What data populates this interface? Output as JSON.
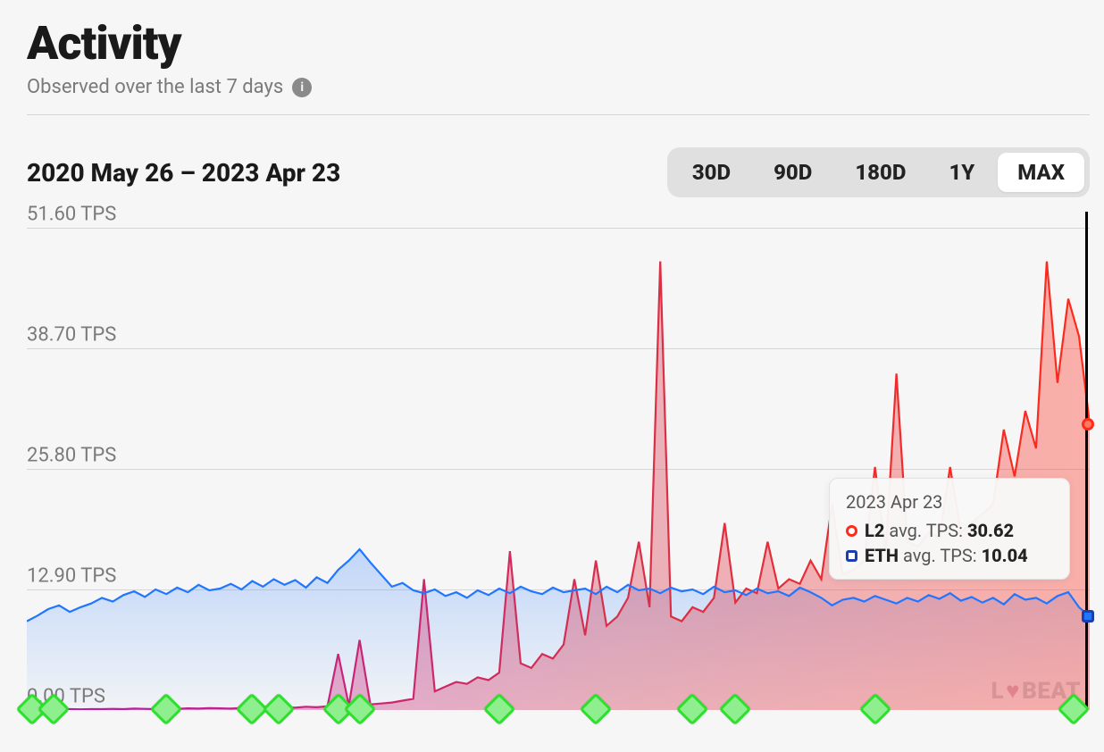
{
  "header": {
    "title": "Activity",
    "subtitle": "Observed over the last 7 days"
  },
  "range_label": "2020 May 26 – 2023 Apr 23",
  "range_options": [
    {
      "label": "30D",
      "active": false
    },
    {
      "label": "90D",
      "active": false
    },
    {
      "label": "180D",
      "active": false
    },
    {
      "label": "1Y",
      "active": false
    },
    {
      "label": "MAX",
      "active": true
    }
  ],
  "y_ticks": [
    "51.60 TPS",
    "38.70 TPS",
    "25.80 TPS",
    "12.90 TPS",
    "0.00 TPS"
  ],
  "tooltip": {
    "date": "2023 Apr 23",
    "l2_label": "L2",
    "l2_metric": "avg. TPS:",
    "l2_value": "30.62",
    "eth_label": "ETH",
    "eth_metric": "avg. TPS:",
    "eth_value": "10.04"
  },
  "watermark": "BEAT",
  "chart_data": {
    "type": "line",
    "title": "Activity",
    "xlabel": "",
    "ylabel": "TPS",
    "ylim": [
      0,
      51.6
    ],
    "x": [
      0,
      1,
      2,
      3,
      4,
      5,
      6,
      7,
      8,
      9,
      10,
      11,
      12,
      13,
      14,
      15,
      16,
      17,
      18,
      19,
      20,
      21,
      22,
      23,
      24,
      25,
      26,
      27,
      28,
      29,
      30,
      31,
      32,
      33,
      34,
      35,
      36,
      37,
      38,
      39,
      40,
      41,
      42,
      43,
      44,
      45,
      46,
      47,
      48,
      49,
      50,
      51,
      52,
      53,
      54,
      55,
      56,
      57,
      58,
      59,
      60,
      61,
      62,
      63,
      64,
      65,
      66,
      67,
      68,
      69,
      70,
      71,
      72,
      73,
      74,
      75,
      76,
      77,
      78,
      79,
      80,
      81,
      82,
      83,
      84,
      85,
      86,
      87,
      88,
      89,
      90,
      91,
      92,
      93,
      94,
      95,
      96,
      97,
      98,
      99
    ],
    "x_domain_label": [
      "2020 May 26",
      "2023 Apr 23"
    ],
    "series": [
      {
        "name": "ETH avg. TPS",
        "color": "#2176ff",
        "values": [
          9.5,
          10.1,
          10.8,
          11.2,
          10.5,
          11.0,
          11.4,
          12.0,
          11.6,
          12.3,
          12.7,
          12.1,
          12.9,
          12.4,
          13.1,
          12.6,
          13.4,
          12.8,
          13.0,
          13.5,
          12.9,
          13.8,
          13.2,
          14.0,
          13.4,
          13.9,
          13.1,
          14.2,
          13.6,
          15.0,
          16.0,
          17.2,
          15.8,
          14.5,
          13.2,
          13.6,
          12.8,
          12.5,
          12.9,
          12.2,
          12.6,
          12.0,
          12.8,
          12.3,
          13.0,
          12.5,
          13.2,
          12.7,
          12.4,
          13.1,
          12.6,
          12.8,
          13.0,
          12.4,
          13.2,
          12.6,
          13.4,
          12.8,
          13.0,
          12.5,
          13.1,
          12.7,
          12.9,
          12.4,
          13.2,
          12.6,
          12.8,
          12.3,
          13.0,
          12.5,
          12.7,
          12.2,
          13.1,
          12.6,
          12.0,
          11.2,
          11.8,
          12.0,
          11.6,
          12.2,
          11.8,
          11.4,
          12.0,
          11.6,
          12.3,
          11.9,
          12.5,
          11.7,
          12.1,
          11.5,
          12.0,
          11.3,
          12.4,
          11.8,
          12.0,
          11.4,
          12.2,
          12.6,
          11.0,
          10.0
        ]
      },
      {
        "name": "L2 avg. TPS",
        "color_gradient": [
          "#b817b2",
          "#ff2a1a"
        ],
        "values": [
          0.0,
          0.05,
          0.05,
          0.1,
          0.1,
          0.08,
          0.1,
          0.1,
          0.12,
          0.1,
          0.15,
          0.12,
          0.1,
          0.15,
          0.12,
          0.18,
          0.15,
          0.2,
          0.18,
          0.15,
          0.2,
          0.18,
          0.25,
          0.2,
          0.3,
          0.25,
          0.35,
          0.3,
          0.4,
          6.0,
          0.5,
          7.5,
          0.6,
          0.7,
          0.8,
          1.0,
          1.2,
          14.0,
          2.0,
          2.5,
          3.0,
          2.8,
          3.5,
          3.2,
          4.0,
          17.0,
          5.0,
          4.5,
          6.0,
          5.5,
          7.0,
          14.0,
          8.0,
          16.0,
          9.0,
          10.0,
          12.0,
          18.0,
          11.0,
          48.0,
          10.0,
          9.5,
          11.0,
          10.5,
          12.0,
          20.0,
          11.5,
          13.0,
          12.5,
          18.0,
          13.0,
          14.0,
          13.5,
          16.0,
          14.0,
          22.0,
          14.5,
          15.0,
          16.0,
          26.0,
          17.0,
          36.0,
          18.0,
          17.5,
          19.0,
          18.5,
          26.0,
          19.0,
          20.0,
          21.0,
          22.0,
          30.0,
          25.0,
          32.0,
          28.0,
          48.0,
          35.0,
          44.0,
          40.0,
          30.62
        ]
      }
    ],
    "event_markers_x": [
      0.5,
      2.5,
      13.0,
      21.0,
      23.5,
      29.0,
      31.0,
      44.0,
      53.0,
      62.0,
      66.0,
      79.0,
      97.5
    ]
  }
}
